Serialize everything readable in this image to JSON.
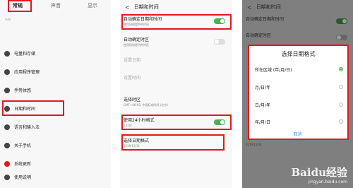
{
  "panel1": {
    "tabs": [
      "常规",
      "声音",
      "显示"
    ],
    "section": "系统",
    "items": [
      "电量和存储",
      "应用程序管理",
      "手势体感",
      "日期和时间",
      "语言和输入法",
      "关于手机",
      "系统更新",
      "使用说明"
    ]
  },
  "panel2": {
    "back": "<",
    "title": "日期和时间",
    "rows": [
      {
        "title": "自动确定日期和时间",
        "sub": "使用网络提供的时间"
      },
      {
        "title": "自动确定时区",
        "sub": "使用网络提供的时区"
      },
      {
        "title": "设置日期",
        "sub": ""
      },
      {
        "title": "设置时间",
        "sub": ""
      },
      {
        "title": "选择时区",
        "sub": "GMT+08:00, 中国标准时间 (北京)"
      },
      {
        "title": "使用24小时格式",
        "sub": "13:00"
      },
      {
        "title": "选择日期格式",
        "sub": "2019/12/31"
      }
    ]
  },
  "panel3": {
    "back": "<",
    "title": "日期和时间",
    "bg_rows": [
      "自动确定日期和时间",
      "自动确定时区"
    ],
    "bottom_sub": "2019/12/31",
    "dialog": {
      "title": "选择日期格式",
      "options": [
        "所在区域 (年/月/日)",
        "月/日/年",
        "日/月/年",
        "年/月/日"
      ],
      "selected": 0,
      "cancel": "取消"
    }
  },
  "watermark": {
    "logo": "Baidu经验",
    "url": "jingyan.baidu.com"
  },
  "colors": {
    "accent_green": "#4caf50",
    "highlight_red": "#e0191e"
  }
}
